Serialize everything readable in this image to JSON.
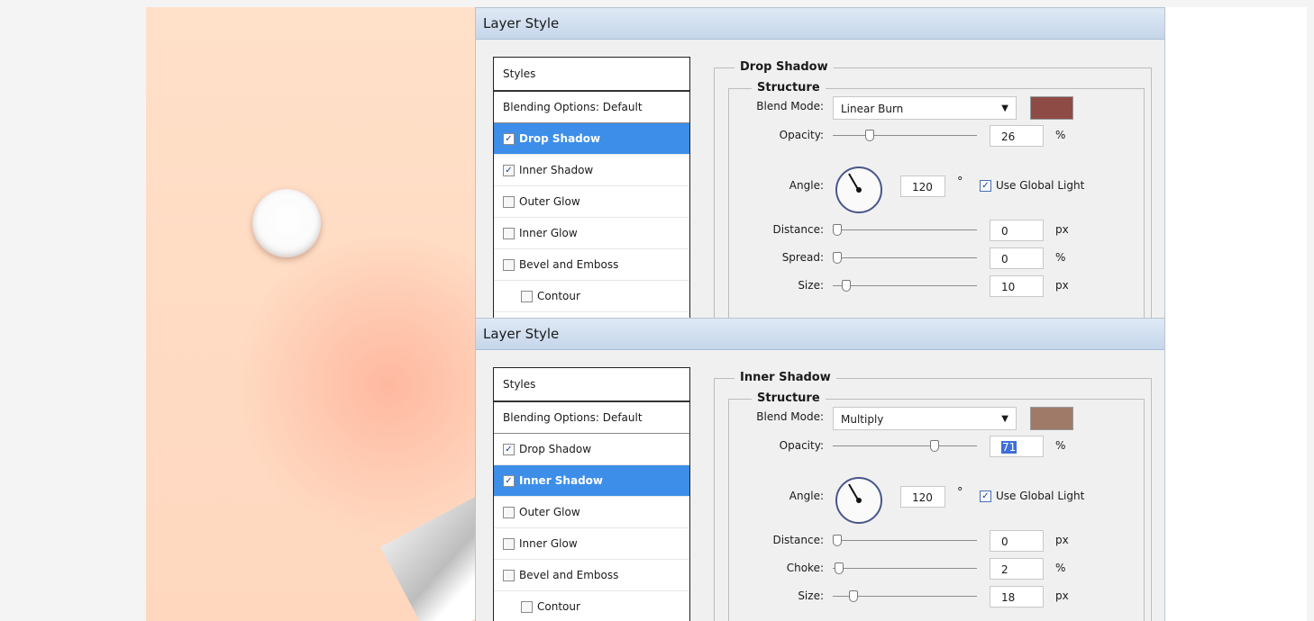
{
  "dialogs": [
    {
      "title": "Layer Style",
      "styles_header": "Styles",
      "blending_item": "Blending Options: Default",
      "items": [
        {
          "label": "Drop Shadow",
          "checked": true,
          "selected": true
        },
        {
          "label": "Inner Shadow",
          "checked": true,
          "selected": false
        },
        {
          "label": "Outer Glow",
          "checked": false,
          "selected": false
        },
        {
          "label": "Inner Glow",
          "checked": false,
          "selected": false
        },
        {
          "label": "Bevel and Emboss",
          "checked": false,
          "selected": false
        },
        {
          "label": "Contour",
          "checked": false,
          "selected": false
        }
      ],
      "panel_title": "Drop Shadow",
      "structure_title": "Structure",
      "blend_mode_label": "Blend Mode:",
      "blend_mode_value": "Linear Burn",
      "color_swatch": "#8e4b45",
      "opacity_label": "Opacity:",
      "opacity_value": "26",
      "opacity_unit": "%",
      "angle_label": "Angle:",
      "angle_value": "120",
      "degree_symbol": "°",
      "use_global_light": "Use Global Light",
      "distance_label": "Distance:",
      "distance_value": "0",
      "distance_unit": "px",
      "third_label": "Spread:",
      "third_value": "0",
      "third_unit": "%",
      "size_label": "Size:",
      "size_value": "10",
      "size_unit": "px"
    },
    {
      "title": "Layer Style",
      "styles_header": "Styles",
      "blending_item": "Blending Options: Default",
      "items": [
        {
          "label": "Drop Shadow",
          "checked": true,
          "selected": false
        },
        {
          "label": "Inner Shadow",
          "checked": true,
          "selected": true
        },
        {
          "label": "Outer Glow",
          "checked": false,
          "selected": false
        },
        {
          "label": "Inner Glow",
          "checked": false,
          "selected": false
        },
        {
          "label": "Bevel and Emboss",
          "checked": false,
          "selected": false
        },
        {
          "label": "Contour",
          "checked": false,
          "selected": false
        }
      ],
      "panel_title": "Inner Shadow",
      "structure_title": "Structure",
      "blend_mode_label": "Blend Mode:",
      "blend_mode_value": "Multiply",
      "color_swatch": "#a07a68",
      "opacity_label": "Opacity:",
      "opacity_value": "71",
      "opacity_unit": "%",
      "angle_label": "Angle:",
      "angle_value": "120",
      "degree_symbol": "°",
      "use_global_light": "Use Global Light",
      "distance_label": "Distance:",
      "distance_value": "0",
      "distance_unit": "px",
      "third_label": "Choke:",
      "third_value": "2",
      "third_unit": "%",
      "size_label": "Size:",
      "size_value": "18",
      "size_unit": "px"
    }
  ]
}
